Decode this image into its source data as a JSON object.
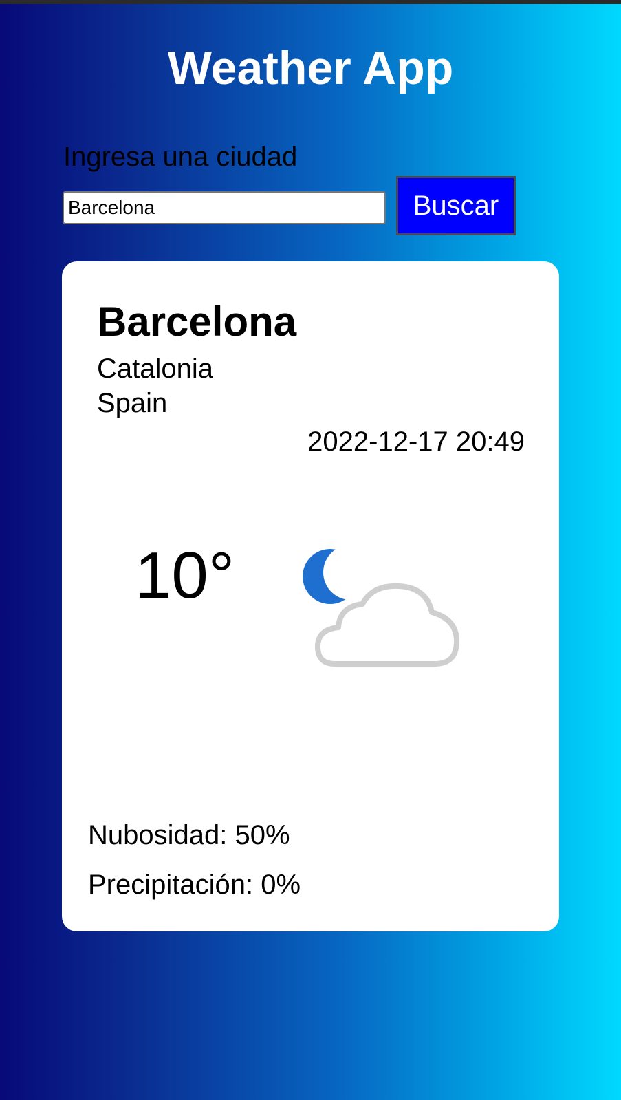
{
  "app": {
    "title": "Weather App"
  },
  "search": {
    "label": "Ingresa una ciudad",
    "value": "Barcelona",
    "button_label": "Buscar"
  },
  "weather": {
    "city": "Barcelona",
    "region": "Catalonia",
    "country": "Spain",
    "local_time": "2022-12-17 20:49",
    "temperature": "10°",
    "condition_icon": "moon-cloud-icon",
    "cloud_cover": "Nubosidad: 50%",
    "precipitation": "Precipitación: 0%"
  },
  "colors": {
    "gradient_start": "#070a78",
    "gradient_end": "#00d9ff",
    "button_bg": "#0000ff",
    "moon": "#1f6fd1",
    "cloud": "#c9c9c9"
  }
}
